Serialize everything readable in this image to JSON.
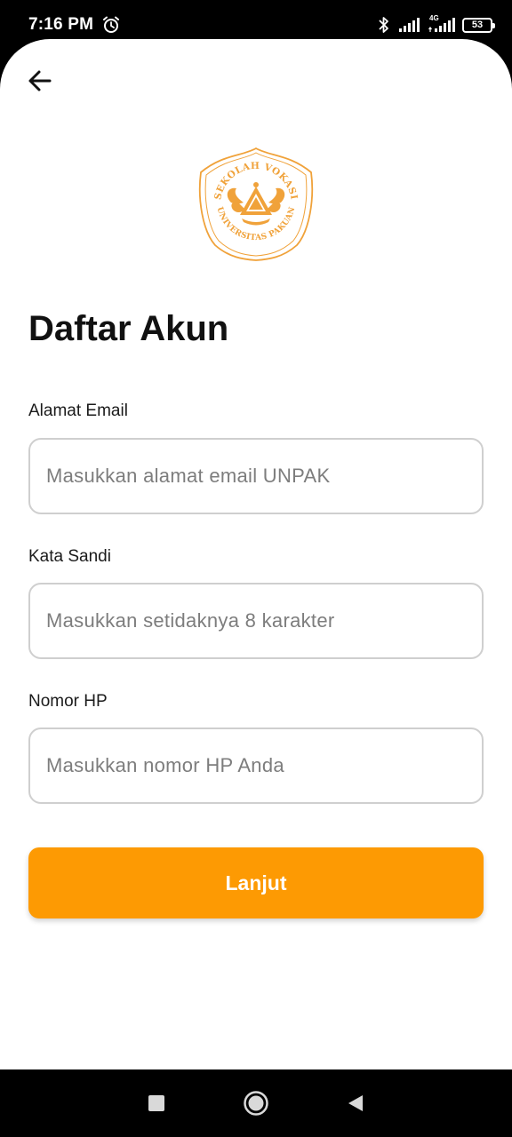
{
  "status_bar": {
    "time": "7:16 PM",
    "network_label": "4G",
    "battery": "53",
    "icons": [
      "alarm-icon",
      "bluetooth-icon",
      "signal-icon",
      "signal-4g-icon",
      "battery-icon"
    ]
  },
  "header": {
    "back_icon": "arrow-left-icon"
  },
  "logo": {
    "top_text": "SEKOLAH VOKASI",
    "bottom_text": "UNIVERSITAS PAKUAN",
    "color": "#f0a23a"
  },
  "form": {
    "title": "Daftar Akun",
    "fields": [
      {
        "label": "Alamat Email",
        "placeholder": "Masukkan alamat email UNPAK",
        "value": ""
      },
      {
        "label": "Kata Sandi",
        "placeholder": "Masukkan setidaknya 8 karakter",
        "value": ""
      },
      {
        "label": "Nomor HP",
        "placeholder": "Masukkan nomor HP Anda",
        "value": ""
      }
    ],
    "submit_label": "Lanjut"
  },
  "colors": {
    "accent": "#fd9a03",
    "input_border": "#cfcfcf",
    "placeholder": "#7d7d7d"
  },
  "nav_bar": {
    "icons": [
      "recents-square-icon",
      "home-circle-icon",
      "back-triangle-icon"
    ]
  }
}
